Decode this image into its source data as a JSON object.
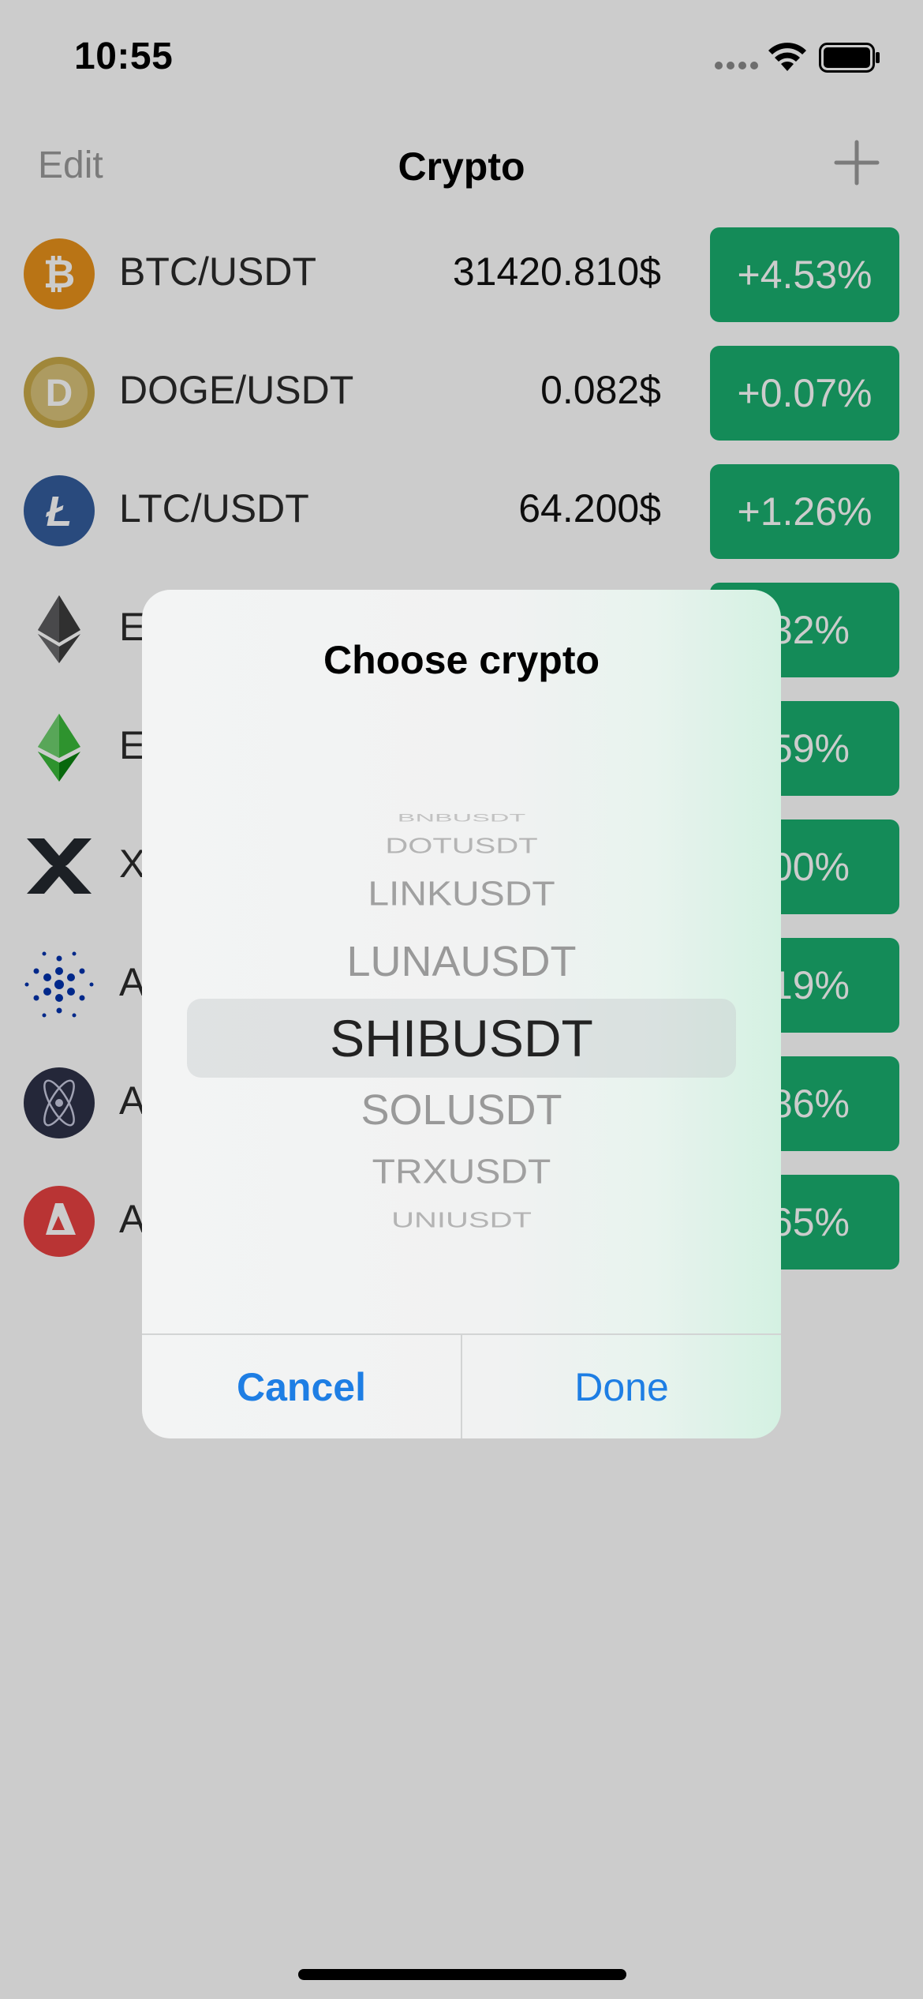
{
  "status_bar": {
    "time": "10:55",
    "icons": [
      "cellular-dots-icon",
      "wifi-icon",
      "battery-icon"
    ]
  },
  "nav": {
    "edit_label": "Edit",
    "title": "Crypto",
    "add_icon": "plus-icon"
  },
  "coins": [
    {
      "pair": "BTC/USDT",
      "price": "31420.810$",
      "change": "+4.53%",
      "icon": "bitcoin-icon",
      "icon_color": "#e8921b"
    },
    {
      "pair": "DOGE/USDT",
      "price": "0.082$",
      "change": "+0.07%",
      "icon": "dogecoin-icon",
      "icon_color": "#c8a949"
    },
    {
      "pair": "LTC/USDT",
      "price": "64.200$",
      "change": "+1.26%",
      "icon": "litecoin-icon",
      "icon_color": "#345d9d"
    },
    {
      "pair": "E",
      "price": "",
      "change": ".32%",
      "icon": "ethereum-icon",
      "icon_color": "#3c3c3d"
    },
    {
      "pair": "E",
      "price": "",
      "change": ".59%",
      "icon": "ethereum-classic-icon",
      "icon_color": "#3ab83a"
    },
    {
      "pair": "X",
      "price": "",
      "change": ".00%",
      "icon": "xrp-icon",
      "icon_color": "#23292f"
    },
    {
      "pair": "A",
      "price": "",
      "change": ".19%",
      "icon": "cardano-icon",
      "icon_color": "#0033ad"
    },
    {
      "pair": "A",
      "price": "",
      "change": ".86%",
      "icon": "cosmos-atom-icon",
      "icon_color": "#2e3148"
    },
    {
      "pair": "A",
      "price": "",
      "change": ".65%",
      "icon": "avalanche-icon",
      "icon_color": "#e84142"
    }
  ],
  "colors": {
    "positive_change": "#1aae6f",
    "accent_blue": "#1e7ee4"
  },
  "dialog": {
    "title": "Choose crypto",
    "picker_options": [
      "BNBUSDT",
      "DOTUSDT",
      "LINKUSDT",
      "LUNAUSDT",
      "SHIBUSDT",
      "SOLUSDT",
      "TRXUSDT",
      "UNIUSDT"
    ],
    "selected": "SHIBUSDT",
    "cancel_label": "Cancel",
    "done_label": "Done"
  }
}
